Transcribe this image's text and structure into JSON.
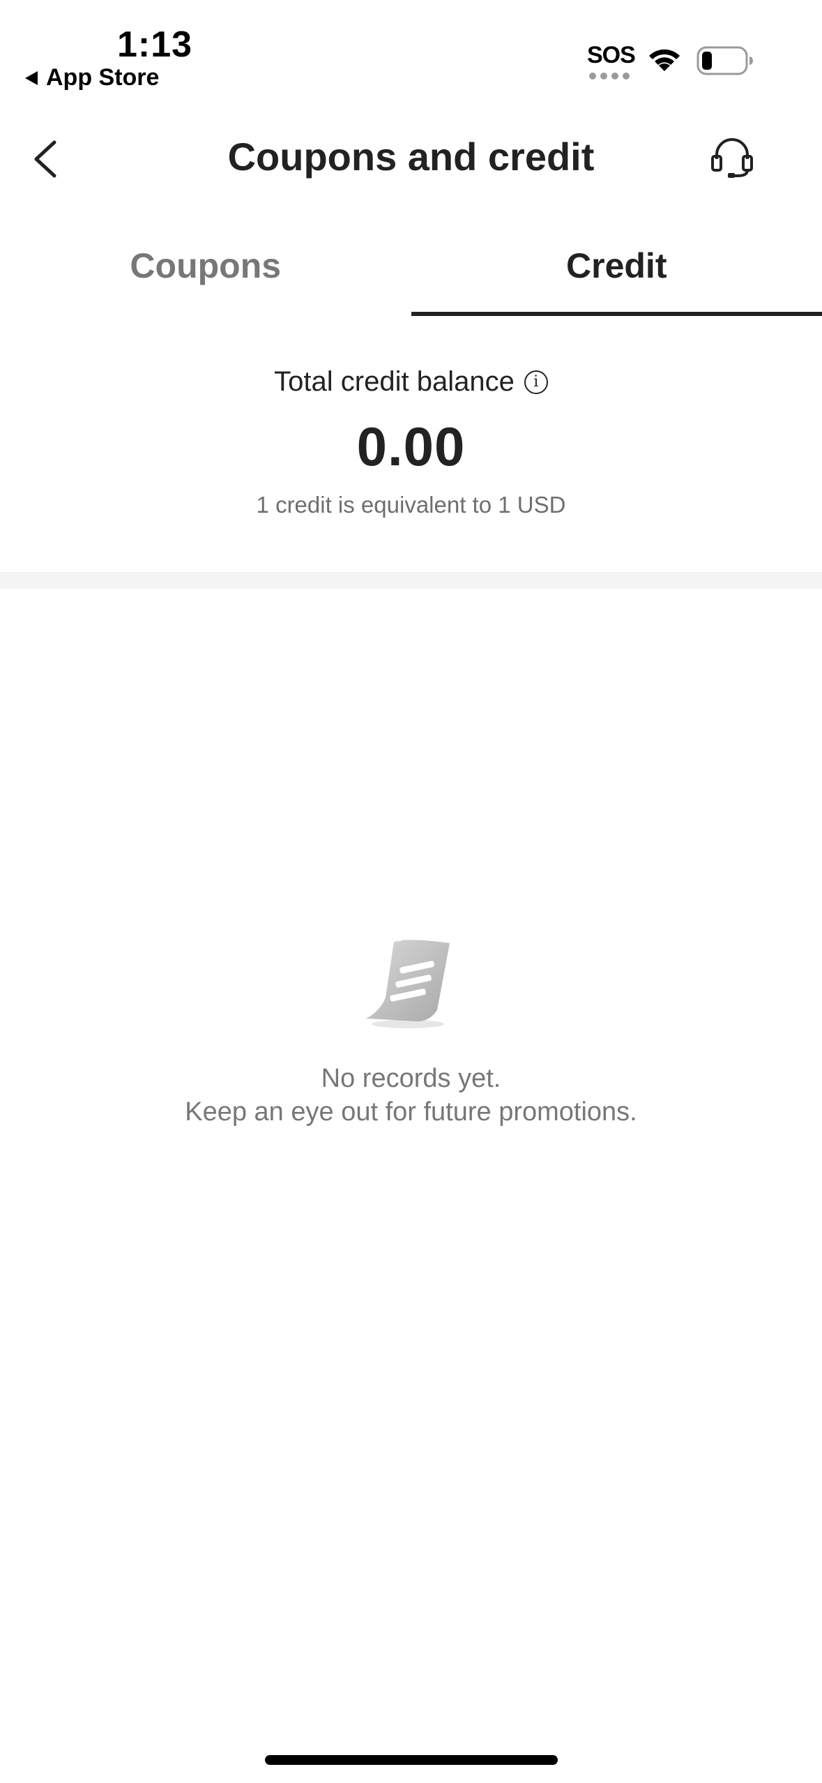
{
  "status_bar": {
    "time": "1:13",
    "back_app": "App Store",
    "sos": "SOS"
  },
  "header": {
    "title": "Coupons and credit",
    "back_icon": "chevron-left-icon",
    "support_icon": "headset-icon"
  },
  "tabs": [
    {
      "label": "Coupons",
      "active": false
    },
    {
      "label": "Credit",
      "active": true
    }
  ],
  "balance": {
    "label": "Total credit balance",
    "info_icon": "i",
    "amount": "0.00",
    "note": "1 credit is equivalent to 1 USD"
  },
  "empty_state": {
    "icon": "document-icon",
    "title": "No records yet.",
    "subtitle": "Keep an eye out for future promotions."
  },
  "colors": {
    "text_primary": "#222222",
    "text_secondary": "#777777",
    "divider": "#f4f4f4"
  }
}
